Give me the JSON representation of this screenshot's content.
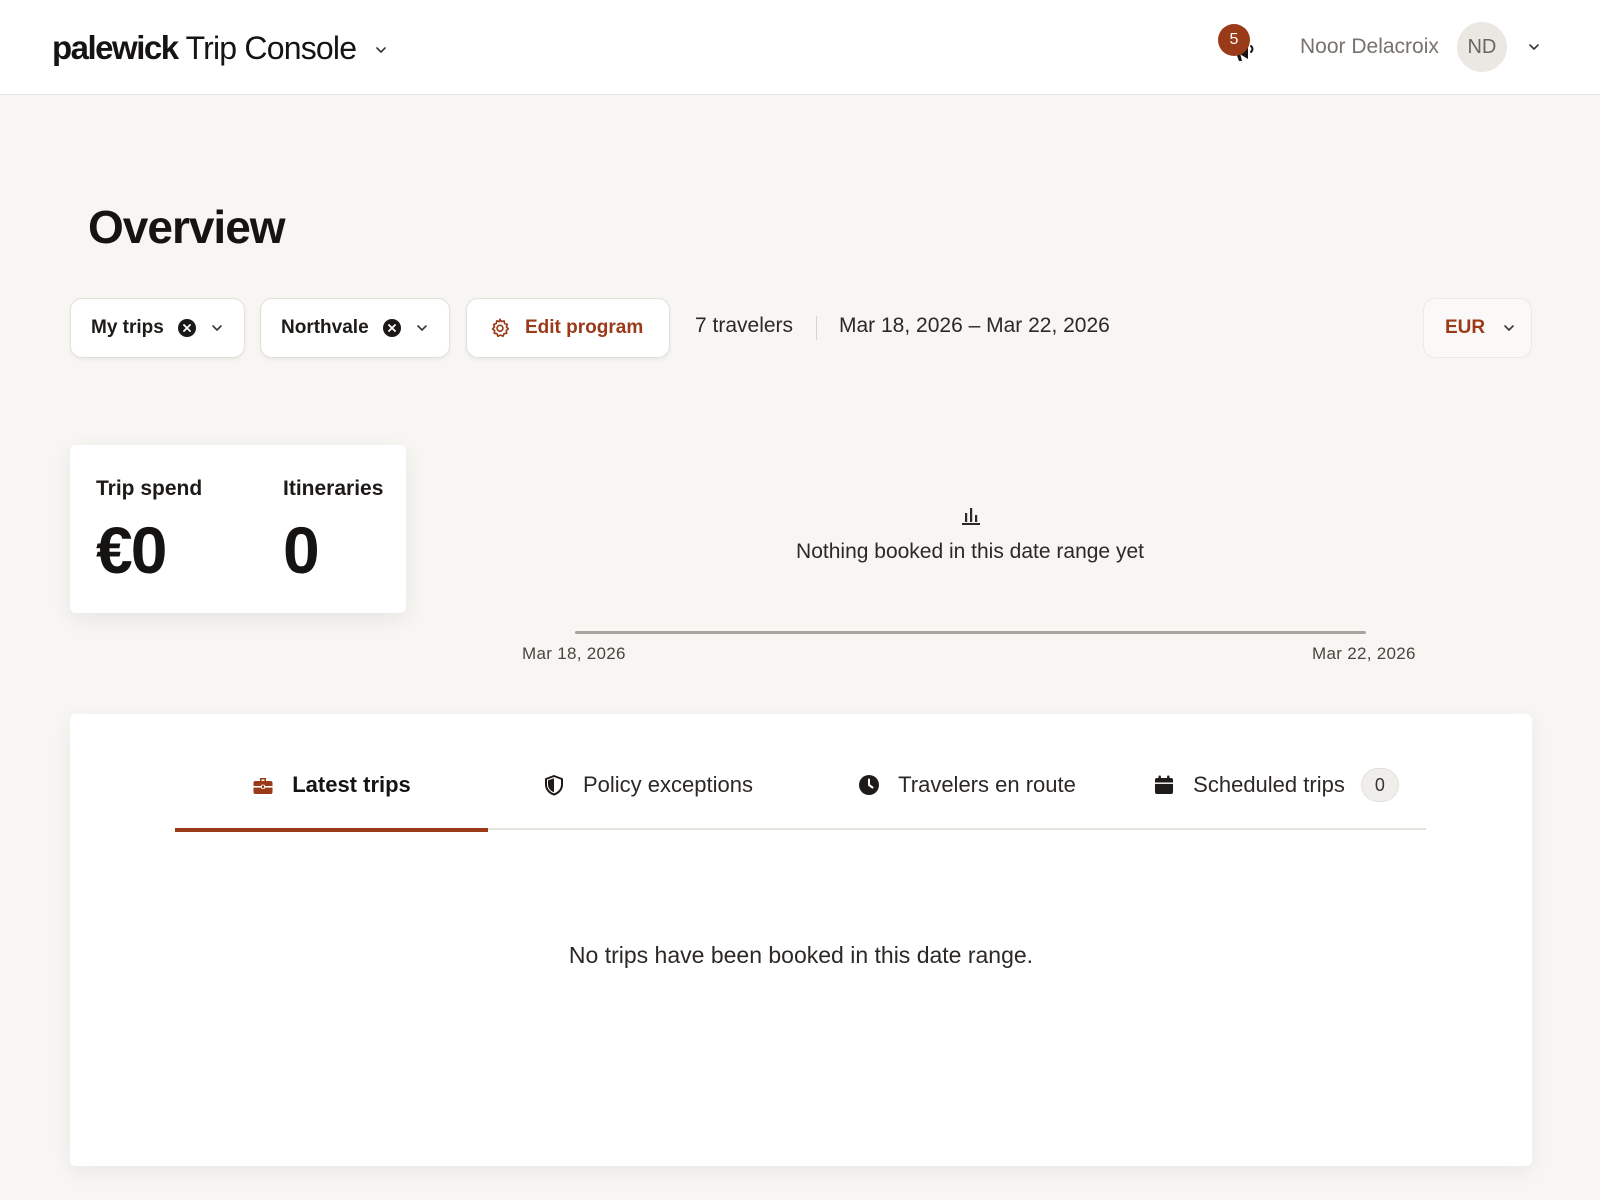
{
  "header": {
    "brand_logo": "palewick",
    "brand_product": "Trip Console",
    "notification_count": "5",
    "user_name": "Noor Delacroix",
    "user_initials": "ND"
  },
  "page": {
    "title": "Overview"
  },
  "filters": {
    "my_trips": "My trips",
    "location": "Northvale",
    "edit_program": "Edit program",
    "travelers": "7 travelers",
    "date_range": "Mar 18, 2026 – Mar 22, 2026",
    "currency": "EUR"
  },
  "stats": {
    "spend_label": "Trip spend",
    "spend_value": "€0",
    "itineraries_label": "Itineraries",
    "itineraries_value": "0"
  },
  "chart": {
    "empty_message": "Nothing booked in this date range yet",
    "start_tick": "Mar 18, 2026",
    "end_tick": "Mar 22, 2026"
  },
  "tabs": {
    "items": [
      {
        "label": "Latest trips",
        "icon": "briefcase-icon",
        "active": true
      },
      {
        "label": "Policy exceptions",
        "icon": "shield-icon",
        "active": false
      },
      {
        "label": "Travelers en route",
        "icon": "clock-icon",
        "active": false
      },
      {
        "label": "Scheduled trips",
        "icon": "calendar-icon",
        "active": false,
        "count": "0"
      }
    ],
    "empty_message": "No trips have been booked in this date range."
  },
  "colors": {
    "accent": "#9a3a18",
    "background": "#f7f6f3",
    "card": "#ffffff",
    "text": "#161412",
    "muted": "#77726c"
  }
}
